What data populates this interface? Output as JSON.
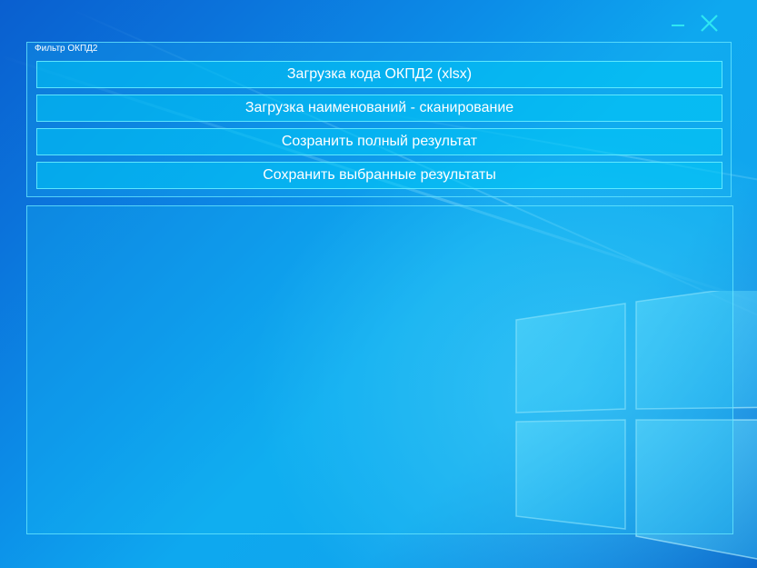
{
  "window": {
    "minimize_icon": "minimize-icon",
    "close_icon": "close-icon",
    "accent_color": "#2ee6f2"
  },
  "filter_group": {
    "title": "Фильтр ОКПД2",
    "buttons": [
      {
        "label": "Загрузка кода ОКПД2 (xlsx)"
      },
      {
        "label": "Загрузка наименований - сканирование"
      },
      {
        "label": "Созранить полный результат"
      },
      {
        "label": "Сохранить выбранные результаты"
      }
    ]
  },
  "result_panel": {
    "content": ""
  },
  "background": {
    "colors": [
      "#0563c9",
      "#0ea8ef",
      "#9fe8ff"
    ]
  }
}
